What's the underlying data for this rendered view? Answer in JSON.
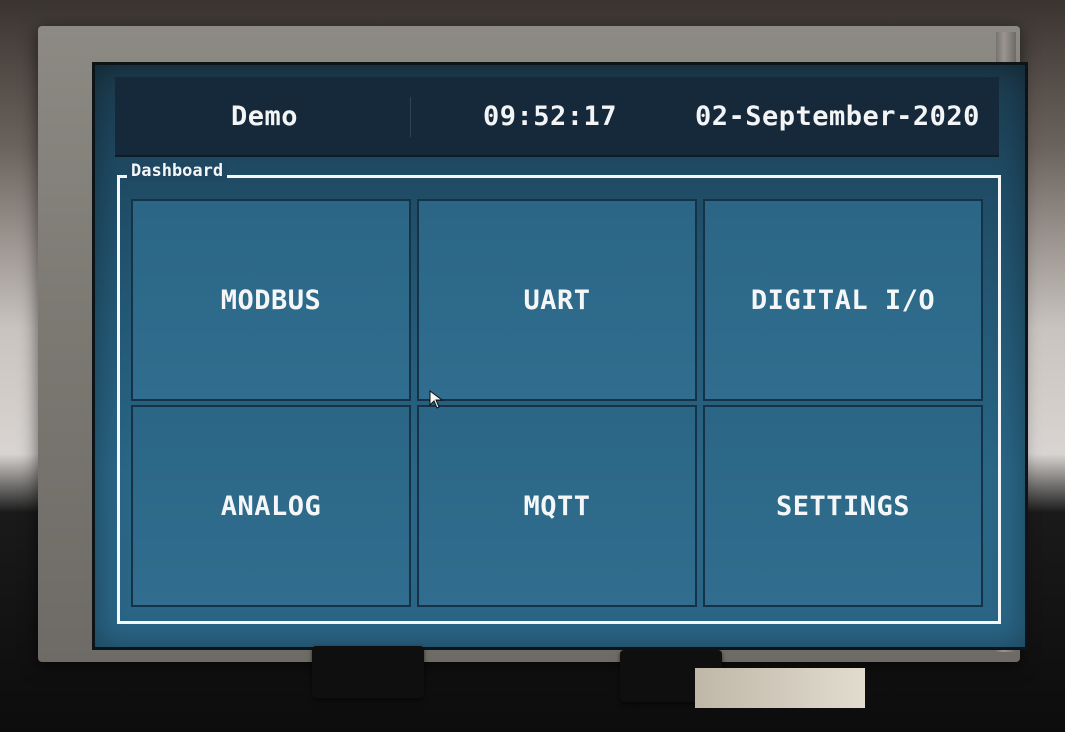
{
  "header": {
    "title": "Demo",
    "time": "09:52:17",
    "date": "02-September-2020"
  },
  "dashboard": {
    "label": "Dashboard",
    "tiles": [
      {
        "label": "MODBUS"
      },
      {
        "label": "UART"
      },
      {
        "label": "DIGITAL I/O"
      },
      {
        "label": "ANALOG"
      },
      {
        "label": "MQTT"
      },
      {
        "label": "SETTINGS"
      }
    ]
  },
  "colors": {
    "screen_bg": "#245a77",
    "header_bg": "#15293a",
    "tile_bg": "#2b6686",
    "text": "#f4f6f7"
  }
}
